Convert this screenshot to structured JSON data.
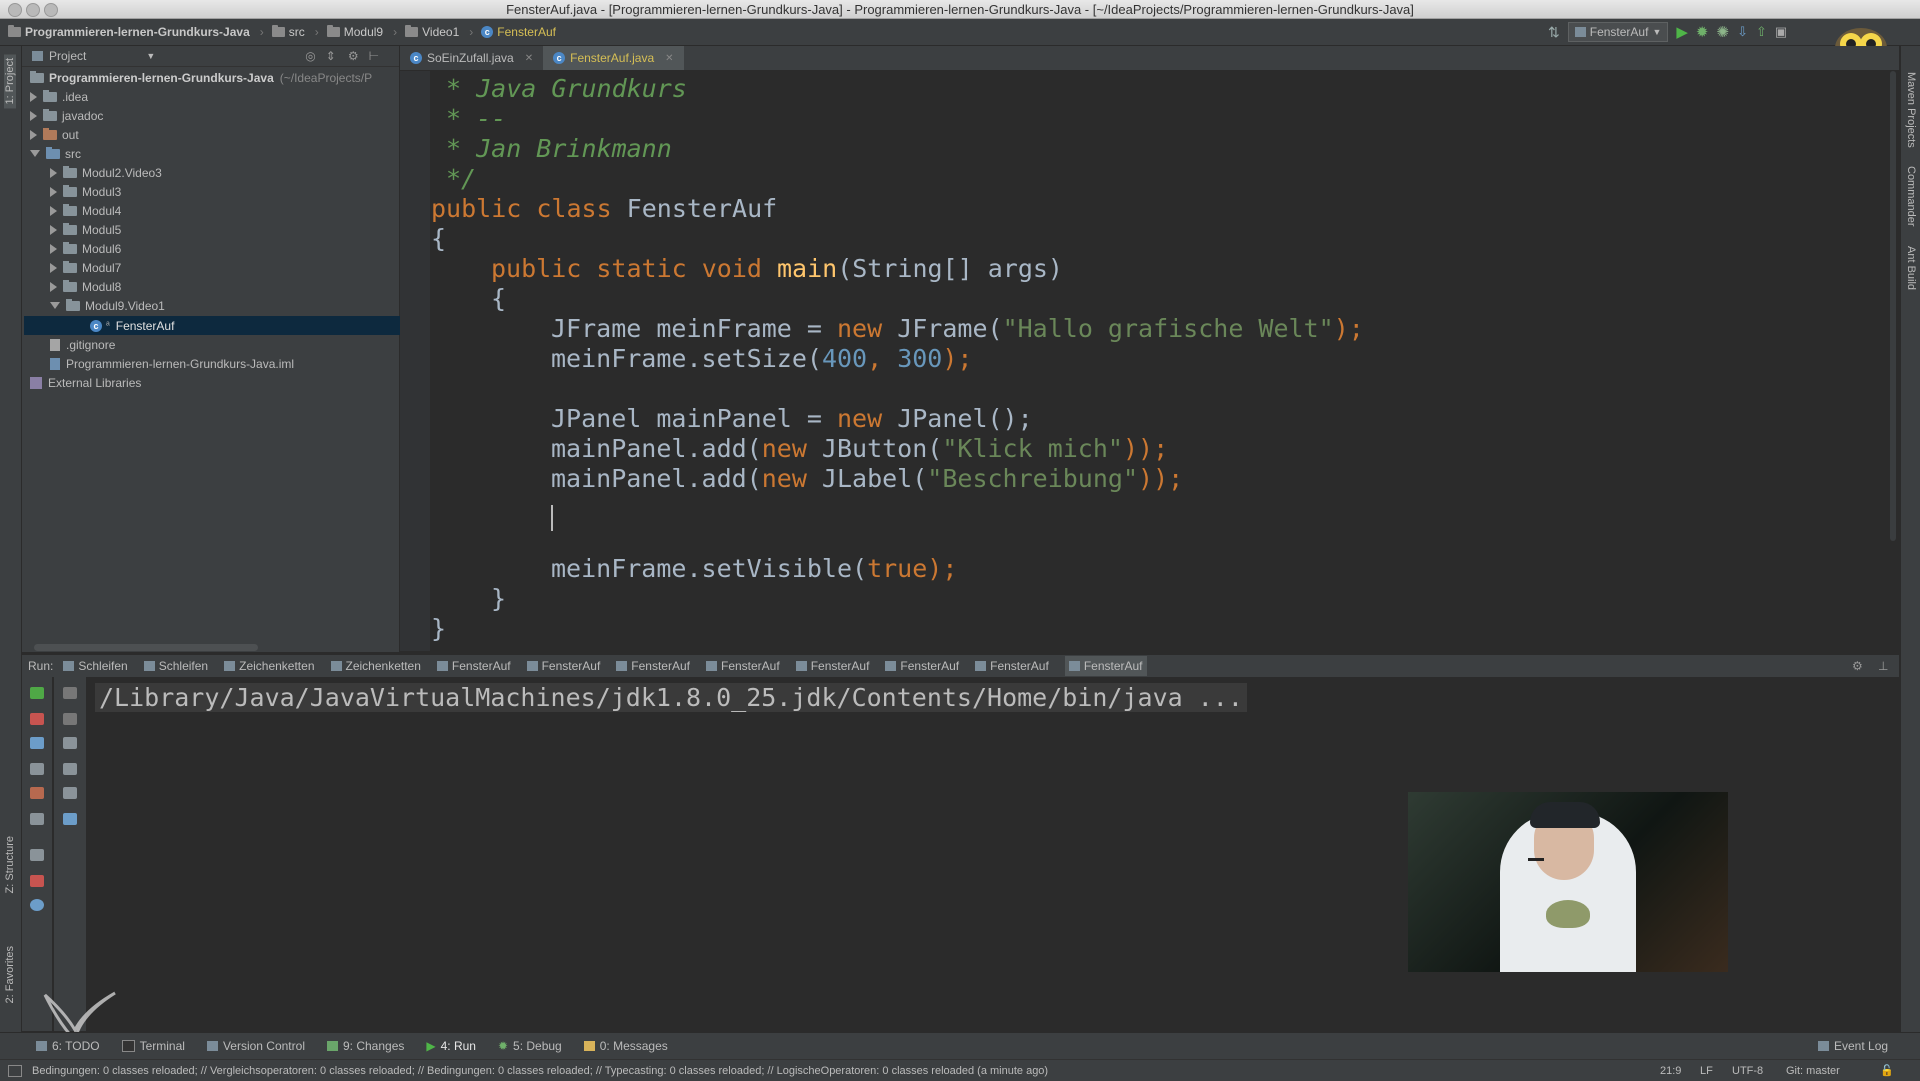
{
  "window": {
    "title": "FensterAuf.java - [Programmieren-lernen-Grundkurs-Java] - Programmieren-lernen-Grundkurs-Java - [~/IdeaProjects/Programmieren-lernen-Grundkurs-Java]"
  },
  "navbar": {
    "crumbs": [
      "Programmieren-lernen-Grundkurs-Java",
      "src",
      "Modul9",
      "Video1",
      "FensterAuf"
    ],
    "run_config": "FensterAuf"
  },
  "project": {
    "header": "Project",
    "root": {
      "name": "Programmieren-lernen-Grundkurs-Java",
      "path": "(~/IdeaProjects/P"
    },
    "items": [
      {
        "label": ".idea"
      },
      {
        "label": "javadoc"
      },
      {
        "label": "out"
      },
      {
        "label": "src"
      },
      {
        "label": "Modul2.Video3"
      },
      {
        "label": "Modul3"
      },
      {
        "label": "Modul4"
      },
      {
        "label": "Modul5"
      },
      {
        "label": "Modul6"
      },
      {
        "label": "Modul7"
      },
      {
        "label": "Modul8"
      },
      {
        "label": "Modul9.Video1"
      },
      {
        "label": "FensterAuf"
      },
      {
        "label": ".gitignore"
      },
      {
        "label": "Programmieren-lernen-Grundkurs-Java.iml"
      },
      {
        "label": "External Libraries"
      }
    ]
  },
  "editor": {
    "tabs": [
      "SoEinZufall.java",
      "FensterAuf.java"
    ],
    "code": {
      "l1": "* Java Grundkurs",
      "l2": "* --",
      "l3": "* Jan Brinkmann",
      "l4": "*/",
      "class_kw": "public class ",
      "class_name": "FensterAuf",
      "brace_open": "{",
      "main_kw": "public static void ",
      "main_name": "main",
      "main_params": "(String[] args)",
      "frame_decl": "JFrame meinFrame = ",
      "new_kw": "new",
      "frame_ctor": " JFrame(",
      "frame_str": "\"Hallo grafische Welt\"",
      "close_semi": ");",
      "setsize_pre": "meinFrame.setSize(",
      "num1": "400",
      "comma": ", ",
      "num2": "300",
      "panel_decl": "JPanel mainPanel = ",
      "panel_ctor": " JPanel();",
      "add_pre": "mainPanel.add(",
      "button_ctor": " JButton(",
      "button_str": "\"Klick mich\"",
      "label_ctor": " JLabel(",
      "label_str": "\"Beschreibung\"",
      "close_double": "));",
      "visible_pre": "meinFrame.setVisible(",
      "true_kw": "true",
      "brace_close": "}"
    }
  },
  "run": {
    "label": "Run:",
    "tabs": [
      "Schleifen",
      "Schleifen",
      "Zeichenketten",
      "Zeichenketten",
      "FensterAuf",
      "FensterAuf",
      "FensterAuf",
      "FensterAuf",
      "FensterAuf",
      "FensterAuf",
      "FensterAuf",
      "FensterAuf"
    ],
    "console": "/Library/Java/JavaVirtualMachines/jdk1.8.0_25.jdk/Contents/Home/bin/java ..."
  },
  "sidestripes": {
    "left_top": "1: Project",
    "left_mid": "Z: Structure",
    "left_bottom": "2: Favorites",
    "right_1": "Maven Projects",
    "right_2": "Commander",
    "right_3": "Ant Build"
  },
  "toolwindows": {
    "items": [
      "6: TODO",
      "Terminal",
      "Version Control",
      "9: Changes",
      "4: Run",
      "5: Debug",
      "0: Messages"
    ],
    "event_log": "Event Log"
  },
  "status": {
    "message": "Bedingungen: 0 classes reloaded; // Vergleichsoperatoren: 0 classes reloaded; // Bedingungen: 0 classes reloaded; // Typecasting: 0 classes reloaded; // LogischeOperatoren: 0 classes reloaded (a minute ago)",
    "position": "21:9",
    "line_sep": "LF",
    "encoding": "UTF-8",
    "vcs": "Git: master"
  }
}
